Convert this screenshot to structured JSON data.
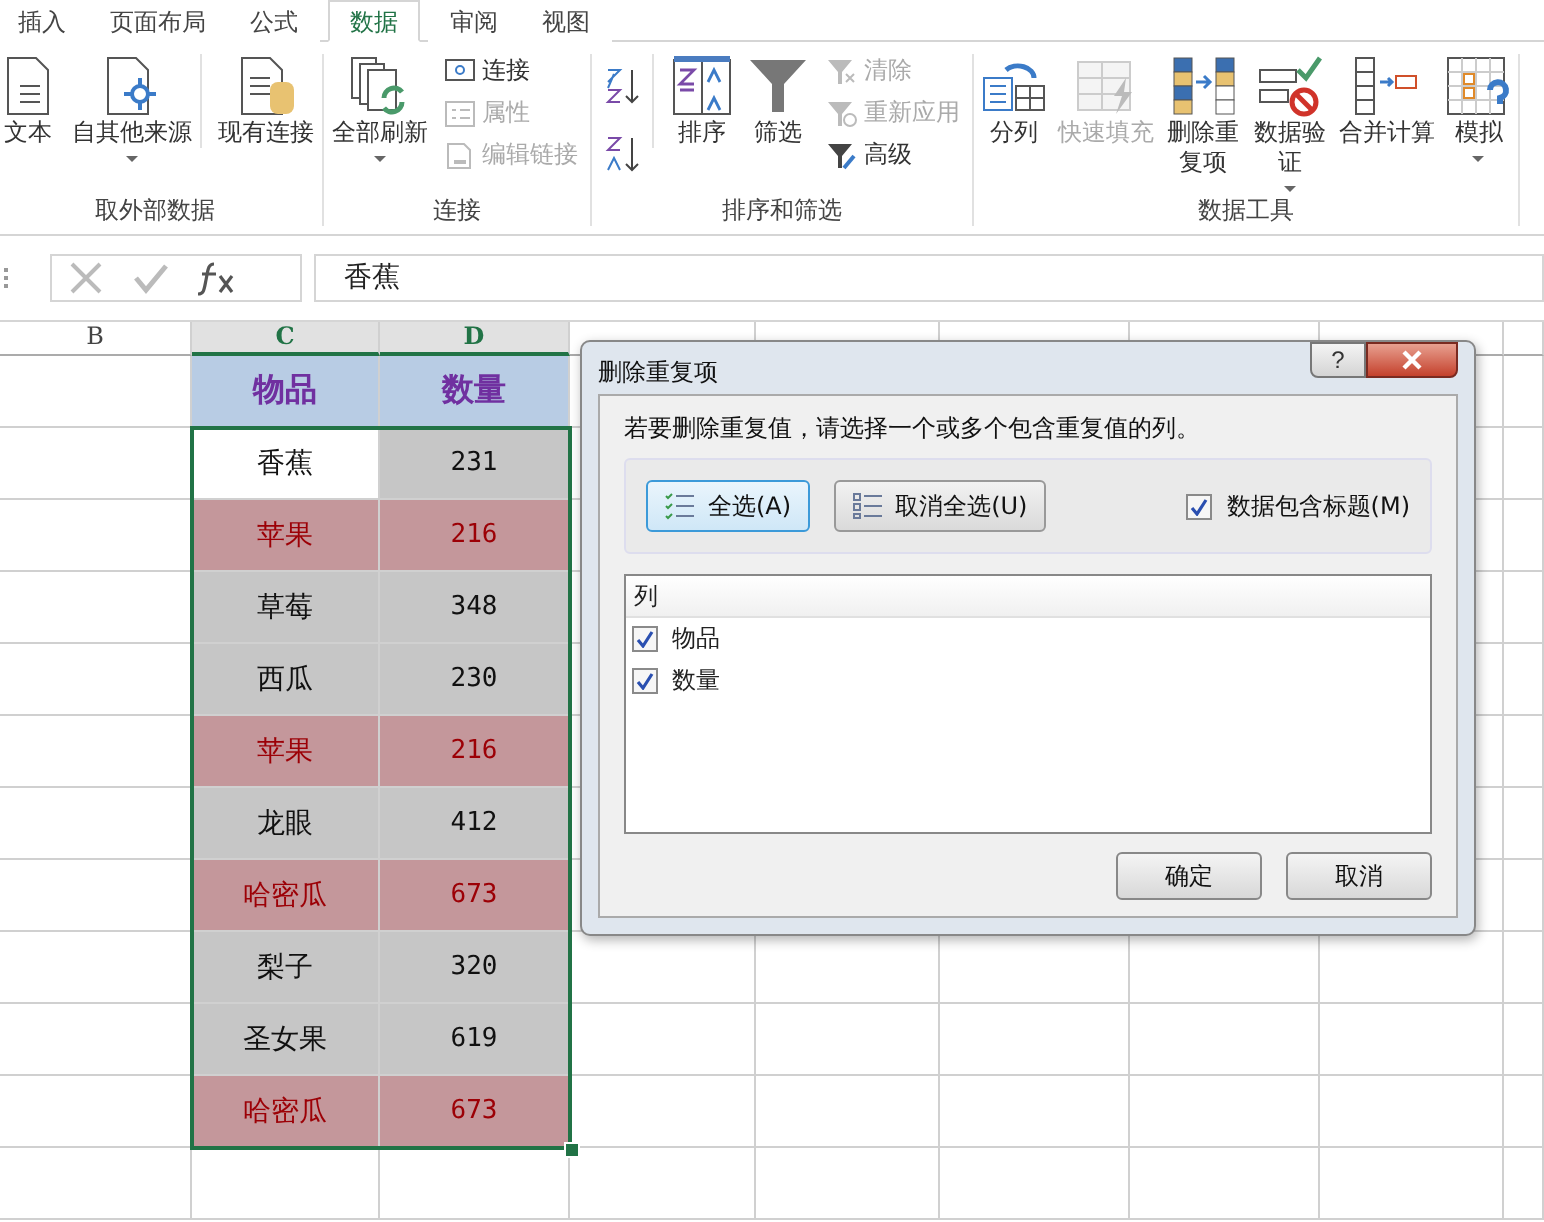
{
  "ribbon_tabs": [
    {
      "label": "插入",
      "selected": false
    },
    {
      "label": "页面布局",
      "selected": false
    },
    {
      "label": "公式",
      "selected": false
    },
    {
      "label": "数据",
      "selected": true
    },
    {
      "label": "审阅",
      "selected": false
    },
    {
      "label": "视图",
      "selected": false
    }
  ],
  "ribbon_groups": [
    {
      "label": "取外部数据",
      "items": [
        {
          "kind": "large",
          "label": "文本",
          "dropdown": false,
          "disabled": false
        },
        {
          "kind": "large",
          "label": "自其他来源",
          "dropdown": true,
          "disabled": false
        },
        {
          "kind": "large",
          "label": "现有连接",
          "dropdown": false,
          "disabled": false
        }
      ]
    },
    {
      "label": "连接",
      "items": [
        {
          "kind": "large",
          "label": "全部刷新",
          "dropdown": true,
          "disabled": false
        },
        {
          "kind": "stack",
          "entries": [
            {
              "label": "连接",
              "disabled": false
            },
            {
              "label": "属性",
              "disabled": true
            },
            {
              "label": "编辑链接",
              "disabled": true
            }
          ]
        }
      ]
    },
    {
      "label": "排序和筛选",
      "items": [
        {
          "kind": "sorticons"
        },
        {
          "kind": "large",
          "label": "排序",
          "dropdown": false,
          "disabled": false
        },
        {
          "kind": "large",
          "label": "筛选",
          "dropdown": false,
          "disabled": false
        },
        {
          "kind": "stack",
          "entries": [
            {
              "label": "清除",
              "disabled": true
            },
            {
              "label": "重新应用",
              "disabled": true
            },
            {
              "label": "高级",
              "disabled": false
            }
          ]
        }
      ]
    },
    {
      "label": "数据工具",
      "items": [
        {
          "kind": "large",
          "label": "分列",
          "dropdown": false,
          "disabled": false
        },
        {
          "kind": "large",
          "label": "快速填充",
          "dropdown": false,
          "disabled": true
        },
        {
          "kind": "tall",
          "label": "删除重复项",
          "dropdown": false,
          "disabled": false
        },
        {
          "kind": "tall",
          "label": "数据验证",
          "dropdown": true,
          "disabled": false
        },
        {
          "kind": "large",
          "label": "合并计算",
          "dropdown": false,
          "disabled": false
        },
        {
          "kind": "large",
          "label": "模拟",
          "dropdown": true,
          "disabled": false
        }
      ]
    }
  ],
  "formula_bar": {
    "value": "香蕉"
  },
  "columns": [
    {
      "label": "B",
      "selected": false
    },
    {
      "label": "C",
      "selected": true
    },
    {
      "label": "D",
      "selected": true
    }
  ],
  "table_header": [
    "物品",
    "数量"
  ],
  "rows": [
    {
      "item": "香蕉",
      "qty": "231",
      "duplicate": false,
      "active": true
    },
    {
      "item": "苹果",
      "qty": "216",
      "duplicate": true,
      "active": false
    },
    {
      "item": "草莓",
      "qty": "348",
      "duplicate": false,
      "active": false
    },
    {
      "item": "西瓜",
      "qty": "230",
      "duplicate": false,
      "active": false
    },
    {
      "item": "苹果",
      "qty": "216",
      "duplicate": true,
      "active": false
    },
    {
      "item": "龙眼",
      "qty": "412",
      "duplicate": false,
      "active": false
    },
    {
      "item": "哈密瓜",
      "qty": "673",
      "duplicate": true,
      "active": false
    },
    {
      "item": "梨子",
      "qty": "320",
      "duplicate": false,
      "active": false
    },
    {
      "item": "圣女果",
      "qty": "619",
      "duplicate": false,
      "active": false
    },
    {
      "item": "哈密瓜",
      "qty": "673",
      "duplicate": true,
      "active": false
    }
  ],
  "dialog": {
    "title": "删除重复项",
    "help": "?",
    "instruction": "若要删除重复值，请选择一个或多个包含重复值的列。",
    "select_all": "全选(A)",
    "unselect_all": "取消全选(U)",
    "has_headers": {
      "label": "数据包含标题(M)",
      "checked": true
    },
    "list_header": "列",
    "columns": [
      {
        "label": "物品",
        "checked": true
      },
      {
        "label": "数量",
        "checked": true
      }
    ],
    "ok": "确定",
    "cancel": "取消"
  }
}
